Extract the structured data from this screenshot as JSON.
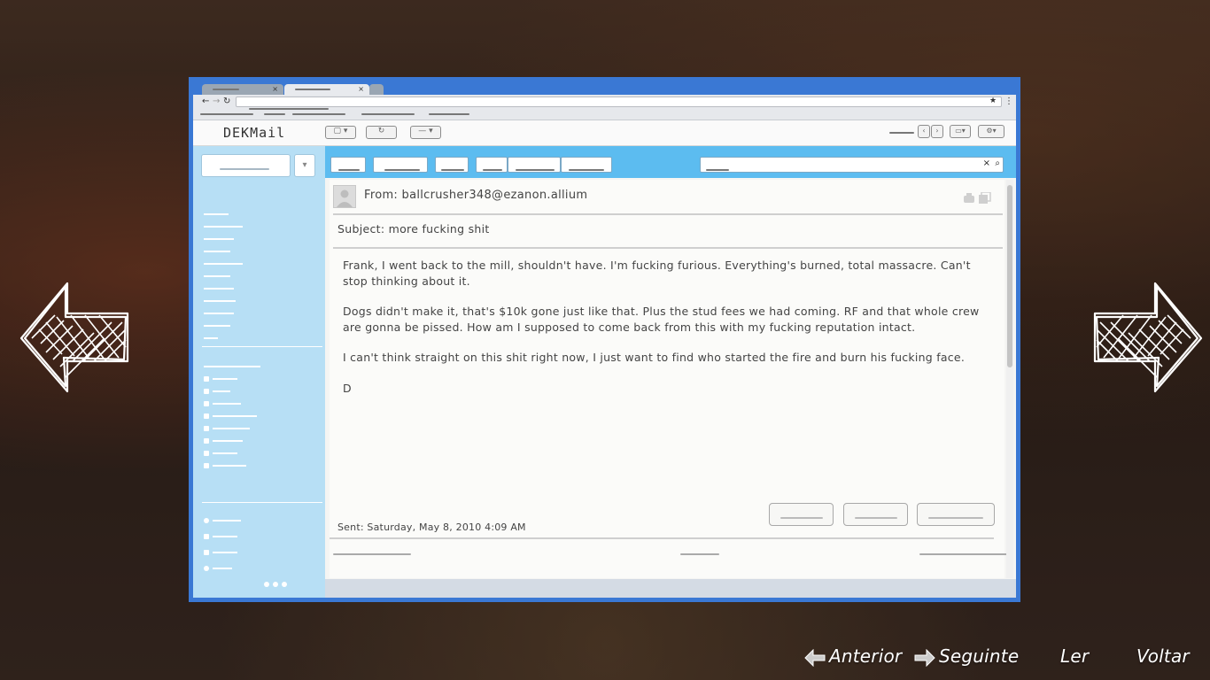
{
  "app": {
    "logo": "DEKMail"
  },
  "email": {
    "from": "From: ballcrusher348@ezanon.allium",
    "subject": "Subject: more fucking shit",
    "paragraphs": [
      "Frank, I went back to the mill, shouldn't have. I'm fucking furious. Everything's burned, total massacre. Can't stop thinking about it.",
      "Dogs didn't make it, that's $10k gone just like that. Plus the stud fees we had coming. RF and that whole crew are gonna be pissed. How am I supposed to come back from this with my fucking reputation intact.",
      "I can't think straight on this shit right now, I just want to find who started the fire and burn his fucking face.",
      "D"
    ],
    "sent": "Sent: Saturday, May 8, 2010 4:09 AM"
  },
  "hints": {
    "previous": "Anterior",
    "next": "Seguinte",
    "read": "Ler",
    "back": "Voltar"
  },
  "icons": {
    "prev_arrow": "left-arrow-icon",
    "next_arrow": "right-arrow-icon"
  },
  "colors": {
    "frame": "#3a78d4",
    "toolbar": "#5cbcf0",
    "sidebar": "#b7dff5"
  }
}
